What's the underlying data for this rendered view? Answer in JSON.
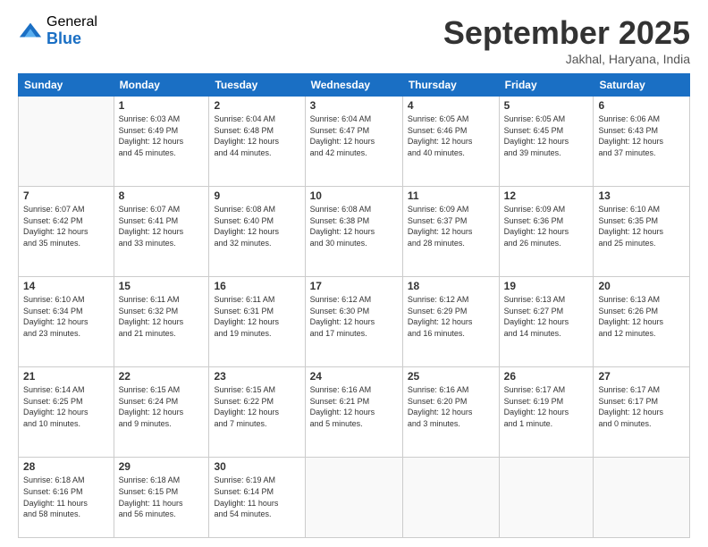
{
  "logo": {
    "general": "General",
    "blue": "Blue"
  },
  "header": {
    "month": "September 2025",
    "location": "Jakhal, Haryana, India"
  },
  "weekdays": [
    "Sunday",
    "Monday",
    "Tuesday",
    "Wednesday",
    "Thursday",
    "Friday",
    "Saturday"
  ],
  "weeks": [
    [
      {
        "day": "",
        "info": ""
      },
      {
        "day": "1",
        "info": "Sunrise: 6:03 AM\nSunset: 6:49 PM\nDaylight: 12 hours\nand 45 minutes."
      },
      {
        "day": "2",
        "info": "Sunrise: 6:04 AM\nSunset: 6:48 PM\nDaylight: 12 hours\nand 44 minutes."
      },
      {
        "day": "3",
        "info": "Sunrise: 6:04 AM\nSunset: 6:47 PM\nDaylight: 12 hours\nand 42 minutes."
      },
      {
        "day": "4",
        "info": "Sunrise: 6:05 AM\nSunset: 6:46 PM\nDaylight: 12 hours\nand 40 minutes."
      },
      {
        "day": "5",
        "info": "Sunrise: 6:05 AM\nSunset: 6:45 PM\nDaylight: 12 hours\nand 39 minutes."
      },
      {
        "day": "6",
        "info": "Sunrise: 6:06 AM\nSunset: 6:43 PM\nDaylight: 12 hours\nand 37 minutes."
      }
    ],
    [
      {
        "day": "7",
        "info": "Sunrise: 6:07 AM\nSunset: 6:42 PM\nDaylight: 12 hours\nand 35 minutes."
      },
      {
        "day": "8",
        "info": "Sunrise: 6:07 AM\nSunset: 6:41 PM\nDaylight: 12 hours\nand 33 minutes."
      },
      {
        "day": "9",
        "info": "Sunrise: 6:08 AM\nSunset: 6:40 PM\nDaylight: 12 hours\nand 32 minutes."
      },
      {
        "day": "10",
        "info": "Sunrise: 6:08 AM\nSunset: 6:38 PM\nDaylight: 12 hours\nand 30 minutes."
      },
      {
        "day": "11",
        "info": "Sunrise: 6:09 AM\nSunset: 6:37 PM\nDaylight: 12 hours\nand 28 minutes."
      },
      {
        "day": "12",
        "info": "Sunrise: 6:09 AM\nSunset: 6:36 PM\nDaylight: 12 hours\nand 26 minutes."
      },
      {
        "day": "13",
        "info": "Sunrise: 6:10 AM\nSunset: 6:35 PM\nDaylight: 12 hours\nand 25 minutes."
      }
    ],
    [
      {
        "day": "14",
        "info": "Sunrise: 6:10 AM\nSunset: 6:34 PM\nDaylight: 12 hours\nand 23 minutes."
      },
      {
        "day": "15",
        "info": "Sunrise: 6:11 AM\nSunset: 6:32 PM\nDaylight: 12 hours\nand 21 minutes."
      },
      {
        "day": "16",
        "info": "Sunrise: 6:11 AM\nSunset: 6:31 PM\nDaylight: 12 hours\nand 19 minutes."
      },
      {
        "day": "17",
        "info": "Sunrise: 6:12 AM\nSunset: 6:30 PM\nDaylight: 12 hours\nand 17 minutes."
      },
      {
        "day": "18",
        "info": "Sunrise: 6:12 AM\nSunset: 6:29 PM\nDaylight: 12 hours\nand 16 minutes."
      },
      {
        "day": "19",
        "info": "Sunrise: 6:13 AM\nSunset: 6:27 PM\nDaylight: 12 hours\nand 14 minutes."
      },
      {
        "day": "20",
        "info": "Sunrise: 6:13 AM\nSunset: 6:26 PM\nDaylight: 12 hours\nand 12 minutes."
      }
    ],
    [
      {
        "day": "21",
        "info": "Sunrise: 6:14 AM\nSunset: 6:25 PM\nDaylight: 12 hours\nand 10 minutes."
      },
      {
        "day": "22",
        "info": "Sunrise: 6:15 AM\nSunset: 6:24 PM\nDaylight: 12 hours\nand 9 minutes."
      },
      {
        "day": "23",
        "info": "Sunrise: 6:15 AM\nSunset: 6:22 PM\nDaylight: 12 hours\nand 7 minutes."
      },
      {
        "day": "24",
        "info": "Sunrise: 6:16 AM\nSunset: 6:21 PM\nDaylight: 12 hours\nand 5 minutes."
      },
      {
        "day": "25",
        "info": "Sunrise: 6:16 AM\nSunset: 6:20 PM\nDaylight: 12 hours\nand 3 minutes."
      },
      {
        "day": "26",
        "info": "Sunrise: 6:17 AM\nSunset: 6:19 PM\nDaylight: 12 hours\nand 1 minute."
      },
      {
        "day": "27",
        "info": "Sunrise: 6:17 AM\nSunset: 6:17 PM\nDaylight: 12 hours\nand 0 minutes."
      }
    ],
    [
      {
        "day": "28",
        "info": "Sunrise: 6:18 AM\nSunset: 6:16 PM\nDaylight: 11 hours\nand 58 minutes."
      },
      {
        "day": "29",
        "info": "Sunrise: 6:18 AM\nSunset: 6:15 PM\nDaylight: 11 hours\nand 56 minutes."
      },
      {
        "day": "30",
        "info": "Sunrise: 6:19 AM\nSunset: 6:14 PM\nDaylight: 11 hours\nand 54 minutes."
      },
      {
        "day": "",
        "info": ""
      },
      {
        "day": "",
        "info": ""
      },
      {
        "day": "",
        "info": ""
      },
      {
        "day": "",
        "info": ""
      }
    ]
  ]
}
